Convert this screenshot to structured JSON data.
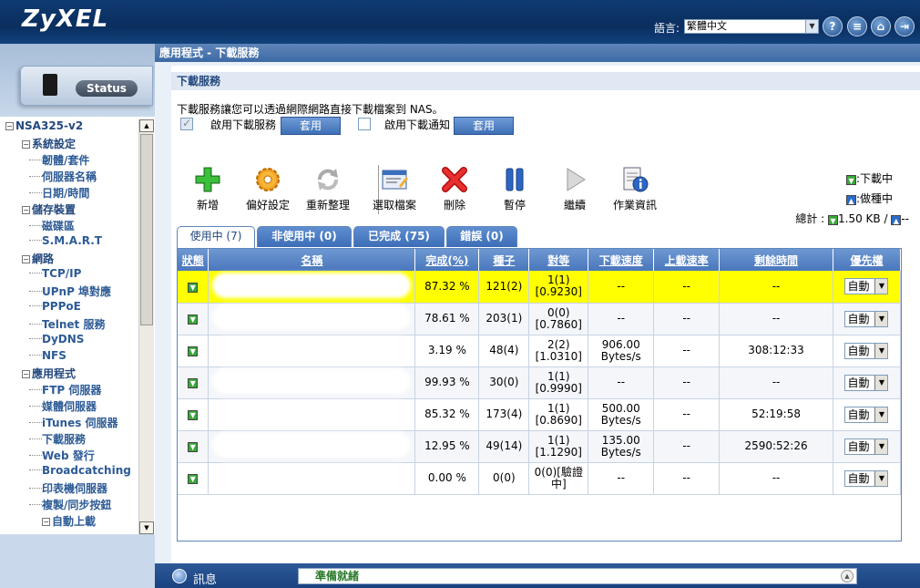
{
  "header": {
    "logo": "ZyXEL",
    "lang_label": "語言:",
    "lang_value": "繁體中文",
    "buttons": [
      "?",
      "≡",
      "⌂",
      "⇥"
    ]
  },
  "sidebar": {
    "status_label": "Status",
    "tree": [
      {
        "label": "NSA325-v2",
        "level": 0
      },
      {
        "label": "系統設定",
        "level": 1
      },
      {
        "label": "韌體/套件",
        "level": 2
      },
      {
        "label": "伺服器名稱",
        "level": 2
      },
      {
        "label": "日期/時間",
        "level": 2
      },
      {
        "label": "儲存裝置",
        "level": 1
      },
      {
        "label": "磁碟區",
        "level": 2
      },
      {
        "label": "S.M.A.R.T",
        "level": 2
      },
      {
        "label": "網路",
        "level": 1
      },
      {
        "label": "TCP/IP",
        "level": 2
      },
      {
        "label": "UPnP 埠對應",
        "level": 2
      },
      {
        "label": "PPPoE",
        "level": 2
      },
      {
        "label": "Telnet 服務",
        "level": 2
      },
      {
        "label": "DyDNS",
        "level": 2
      },
      {
        "label": "NFS",
        "level": 2
      },
      {
        "label": "應用程式",
        "level": 1
      },
      {
        "label": "FTP 伺服器",
        "level": 2
      },
      {
        "label": "媒體伺服器",
        "level": 2
      },
      {
        "label": "iTunes 伺服器",
        "level": 2
      },
      {
        "label": "下載服務",
        "level": 2
      },
      {
        "label": "Web 發行",
        "level": 2
      },
      {
        "label": "Broadcatching",
        "level": 2
      },
      {
        "label": "印表機伺服器",
        "level": 2
      },
      {
        "label": "複製/同步按鈕",
        "level": 2
      },
      {
        "label": "自動上載",
        "level": 2
      }
    ]
  },
  "page": {
    "breadcrumb": "應用程式 - 下載服務",
    "section_title": "下載服務",
    "description": "下載服務讓您可以透過網際網路直接下載檔案到 NAS。",
    "enable_service_label": "啟用下載服務",
    "enable_notify_label": "啟用下載通知",
    "apply_label": "套用"
  },
  "toolbar": [
    {
      "name": "add",
      "label": "新增",
      "icon": "plus-icon"
    },
    {
      "name": "preferences",
      "label": "偏好設定",
      "icon": "gear-icon"
    },
    {
      "name": "rearrange",
      "label": "重新整理",
      "icon": "refresh-icon"
    },
    {
      "name": "select-files",
      "label": "選取檔案",
      "icon": "file-select-icon"
    },
    {
      "name": "delete",
      "label": "刪除",
      "icon": "delete-icon"
    },
    {
      "name": "pause",
      "label": "暫停",
      "icon": "pause-icon"
    },
    {
      "name": "resume",
      "label": "繼續",
      "icon": "play-icon"
    },
    {
      "name": "job-info",
      "label": "作業資訊",
      "icon": "info-icon"
    }
  ],
  "legend": {
    "download_label": ":下載中",
    "seeding_label": ":做種中",
    "total_label": "總計 :",
    "down_rate": "1.50 KB /",
    "up_rate": "--"
  },
  "tabs": [
    "使用中 (7)",
    "非使用中 (0)",
    "已完成 (75)",
    "錯誤 (0)"
  ],
  "table": {
    "headers": [
      "狀態",
      "名稱",
      "完成(%)",
      "種子",
      "對等",
      "下載速度",
      "上載速率",
      "剩餘時間",
      "優先權"
    ],
    "rows": [
      {
        "complete": "87.32 %",
        "seeds": "121(2)",
        "peers1": "1(1)",
        "peers2": "[0.9230]",
        "down1": "--",
        "down2": "",
        "up": "--",
        "remain": "--",
        "priority": "自動"
      },
      {
        "complete": "78.61 %",
        "seeds": "203(1)",
        "peers1": "0(0)",
        "peers2": "[0.7860]",
        "down1": "--",
        "down2": "",
        "up": "--",
        "remain": "--",
        "priority": "自動"
      },
      {
        "complete": "3.19 %",
        "seeds": "48(4)",
        "peers1": "2(2)",
        "peers2": "[1.0310]",
        "down1": "906.00",
        "down2": "Bytes/s",
        "up": "--",
        "remain": "308:12:33",
        "priority": "自動"
      },
      {
        "complete": "99.93 %",
        "seeds": "30(0)",
        "peers1": "1(1)",
        "peers2": "[0.9990]",
        "down1": "--",
        "down2": "",
        "up": "--",
        "remain": "--",
        "priority": "自動"
      },
      {
        "complete": "85.32 %",
        "seeds": "173(4)",
        "peers1": "1(1)",
        "peers2": "[0.8690]",
        "down1": "500.00",
        "down2": "Bytes/s",
        "up": "--",
        "remain": "52:19:58",
        "priority": "自動"
      },
      {
        "complete": "12.95 %",
        "seeds": "49(14)",
        "peers1": "1(1)",
        "peers2": "[1.1290]",
        "down1": "135.00",
        "down2": "Bytes/s",
        "up": "--",
        "remain": "2590:52:26",
        "priority": "自動"
      },
      {
        "complete": "0.00 %",
        "seeds": "0(0)",
        "peers1": "0(0)[驗證",
        "peers2": "中]",
        "down1": "--",
        "down2": "",
        "up": "--",
        "remain": "--",
        "priority": "自動"
      }
    ]
  },
  "statusbar": {
    "label": "訊息",
    "message": "準備就緒"
  }
}
